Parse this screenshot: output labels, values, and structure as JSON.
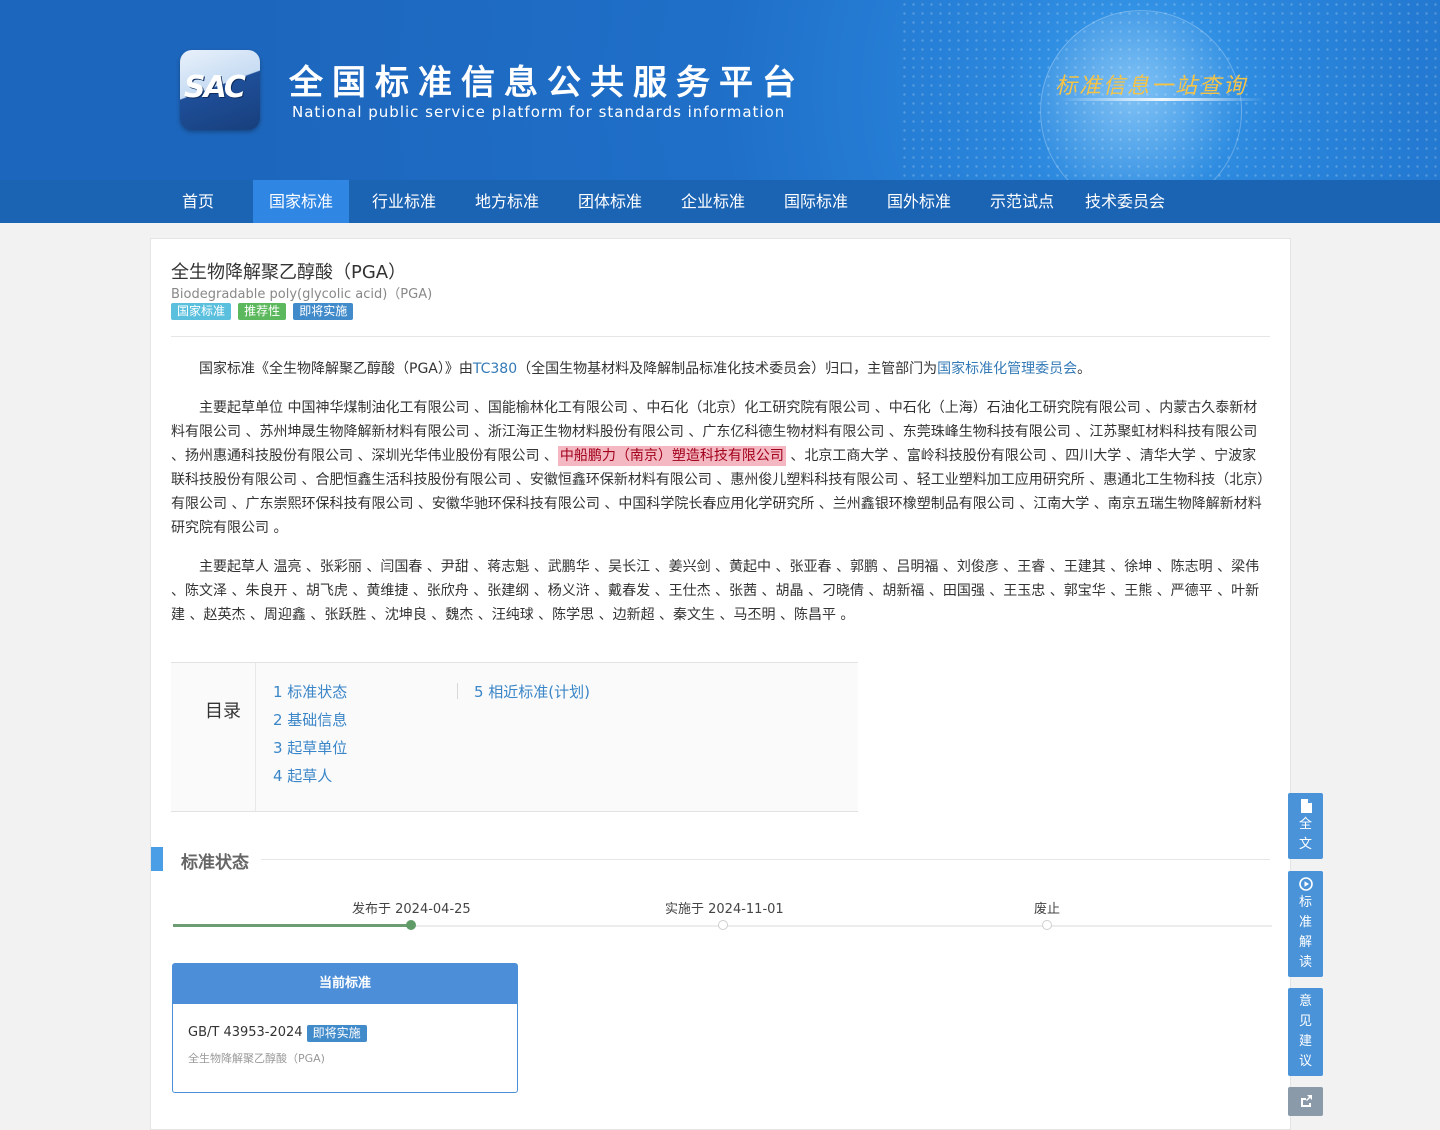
{
  "site": {
    "logo_text": "SAC",
    "title": "全国标准信息公共服务平台",
    "subtitle": "National public service platform  for standards information",
    "slogan": "标准信息一站查询"
  },
  "nav": {
    "items": [
      "首页",
      "国家标准",
      "行业标准",
      "地方标准",
      "团体标准",
      "企业标准",
      "国际标准",
      "国外标准",
      "示范试点",
      "技术委员会"
    ],
    "active": "国家标准"
  },
  "standard": {
    "title": "全生物降解聚乙醇酸（PGA）",
    "en_title": "Biodegradable poly(glycolic acid)（PGA)",
    "tags": [
      {
        "label": "国家标准",
        "color": "#5bc0de"
      },
      {
        "label": "推荐性",
        "color": "#5cb85c"
      },
      {
        "label": "即将实施",
        "color": "#428bca"
      }
    ]
  },
  "intro": {
    "prefix": "国家标准《全生物降解聚乙醇酸（PGA）》由",
    "tc_link": "TC380",
    "middle": "（全国生物基材料及降解制品标准化技术委员会）归口，主管部门为",
    "dept_link": "国家标准化管理委员会",
    "suffix": "。"
  },
  "drafting_units": {
    "label": "主要起草单位 ",
    "before_highlight": "中国神华煤制油化工有限公司 、国能榆林化工有限公司 、中石化（北京）化工研究院有限公司 、中石化（上海）石油化工研究院有限公司 、内蒙古久泰新材料有限公司 、苏州坤晟生物降解新材料有限公司 、浙江海正生物材料股份有限公司 、广东亿科德生物材料有限公司 、东莞珠峰生物科技有限公司 、江苏聚虹材料科技有限公司 、扬州惠通科技股份有限公司 、深圳光华伟业股份有限公司 、",
    "highlight": "中船鹏力（南京）塑造科技有限公司",
    "after_highlight": " 、北京工商大学 、富岭科技股份有限公司 、四川大学 、清华大学 、宁波家联科技股份有限公司 、合肥恒鑫生活科技股份有限公司 、安徽恒鑫环保新材料有限公司 、惠州俊儿塑料科技有限公司 、轻工业塑料加工应用研究所 、惠通北工生物科技（北京）有限公司 、广东崇熙环保科技有限公司 、安徽华驰环保科技有限公司 、中国科学院长春应用化学研究所 、兰州鑫银环橡塑制品有限公司 、江南大学 、南京五瑞生物降解新材料研究院有限公司 。"
  },
  "drafters": {
    "label": "主要起草人 ",
    "text": "温亮 、张彩丽 、闫国春 、尹甜 、蒋志魁 、武鹏华 、吴长江 、姜兴剑 、黄起中 、张亚春 、郭鹏 、吕明福 、刘俊彦 、王睿 、王建其 、徐坤 、陈志明 、梁伟 、陈文泽 、朱良开 、胡飞虎 、黄维捷 、张欣舟 、张建纲 、杨义浒 、戴春发 、王仕杰 、张茜 、胡晶 、刁晓倩 、胡新福 、田国强 、王玉忠 、郭宝华 、王熊 、严德平 、叶新建 、赵英杰 、周迎鑫 、张跃胜 、沈坤良 、魏杰 、汪纯球 、陈学思 、边新超 、秦文生 、马丕明 、陈昌平 。"
  },
  "toc": {
    "label": "目录",
    "items": [
      "1  标准状态",
      "2  基础信息",
      "3  起草单位",
      "4  起草人",
      "5  相近标准(计划)"
    ]
  },
  "status_section": {
    "title": "标准状态",
    "timeline": {
      "published": "发布于 2024-04-25",
      "implemented": "实施于 2024-11-01",
      "abolished": "废止",
      "current_step": 1
    },
    "current_standard": {
      "header": "当前标准",
      "code": "GB/T 43953-2024",
      "badge": "即将实施",
      "name": "全生物降解聚乙醇酸（PGA)"
    }
  },
  "side_buttons": {
    "fulltext": [
      "全",
      "文"
    ],
    "interpret": [
      "标",
      "准",
      "解",
      "读"
    ],
    "feedback": [
      "意",
      "见",
      "建",
      "议"
    ]
  }
}
